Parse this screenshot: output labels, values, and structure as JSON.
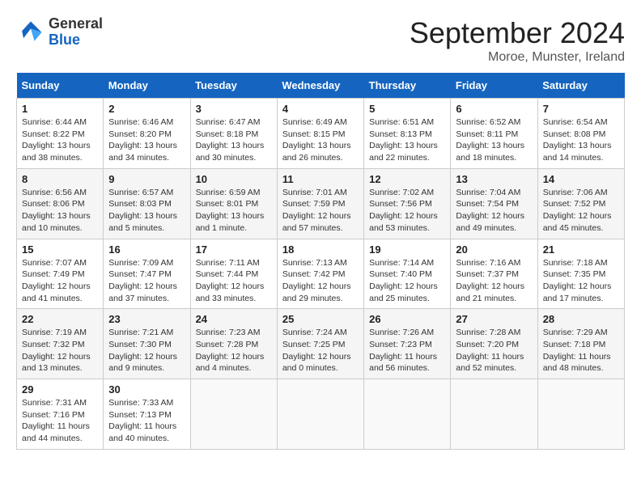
{
  "header": {
    "logo_line1": "General",
    "logo_line2": "Blue",
    "month": "September 2024",
    "location": "Moroe, Munster, Ireland"
  },
  "days_of_week": [
    "Sunday",
    "Monday",
    "Tuesday",
    "Wednesday",
    "Thursday",
    "Friday",
    "Saturday"
  ],
  "weeks": [
    [
      {
        "day": "1",
        "info": "Sunrise: 6:44 AM\nSunset: 8:22 PM\nDaylight: 13 hours\nand 38 minutes."
      },
      {
        "day": "2",
        "info": "Sunrise: 6:46 AM\nSunset: 8:20 PM\nDaylight: 13 hours\nand 34 minutes."
      },
      {
        "day": "3",
        "info": "Sunrise: 6:47 AM\nSunset: 8:18 PM\nDaylight: 13 hours\nand 30 minutes."
      },
      {
        "day": "4",
        "info": "Sunrise: 6:49 AM\nSunset: 8:15 PM\nDaylight: 13 hours\nand 26 minutes."
      },
      {
        "day": "5",
        "info": "Sunrise: 6:51 AM\nSunset: 8:13 PM\nDaylight: 13 hours\nand 22 minutes."
      },
      {
        "day": "6",
        "info": "Sunrise: 6:52 AM\nSunset: 8:11 PM\nDaylight: 13 hours\nand 18 minutes."
      },
      {
        "day": "7",
        "info": "Sunrise: 6:54 AM\nSunset: 8:08 PM\nDaylight: 13 hours\nand 14 minutes."
      }
    ],
    [
      {
        "day": "8",
        "info": "Sunrise: 6:56 AM\nSunset: 8:06 PM\nDaylight: 13 hours\nand 10 minutes."
      },
      {
        "day": "9",
        "info": "Sunrise: 6:57 AM\nSunset: 8:03 PM\nDaylight: 13 hours\nand 5 minutes."
      },
      {
        "day": "10",
        "info": "Sunrise: 6:59 AM\nSunset: 8:01 PM\nDaylight: 13 hours\nand 1 minute."
      },
      {
        "day": "11",
        "info": "Sunrise: 7:01 AM\nSunset: 7:59 PM\nDaylight: 12 hours\nand 57 minutes."
      },
      {
        "day": "12",
        "info": "Sunrise: 7:02 AM\nSunset: 7:56 PM\nDaylight: 12 hours\nand 53 minutes."
      },
      {
        "day": "13",
        "info": "Sunrise: 7:04 AM\nSunset: 7:54 PM\nDaylight: 12 hours\nand 49 minutes."
      },
      {
        "day": "14",
        "info": "Sunrise: 7:06 AM\nSunset: 7:52 PM\nDaylight: 12 hours\nand 45 minutes."
      }
    ],
    [
      {
        "day": "15",
        "info": "Sunrise: 7:07 AM\nSunset: 7:49 PM\nDaylight: 12 hours\nand 41 minutes."
      },
      {
        "day": "16",
        "info": "Sunrise: 7:09 AM\nSunset: 7:47 PM\nDaylight: 12 hours\nand 37 minutes."
      },
      {
        "day": "17",
        "info": "Sunrise: 7:11 AM\nSunset: 7:44 PM\nDaylight: 12 hours\nand 33 minutes."
      },
      {
        "day": "18",
        "info": "Sunrise: 7:13 AM\nSunset: 7:42 PM\nDaylight: 12 hours\nand 29 minutes."
      },
      {
        "day": "19",
        "info": "Sunrise: 7:14 AM\nSunset: 7:40 PM\nDaylight: 12 hours\nand 25 minutes."
      },
      {
        "day": "20",
        "info": "Sunrise: 7:16 AM\nSunset: 7:37 PM\nDaylight: 12 hours\nand 21 minutes."
      },
      {
        "day": "21",
        "info": "Sunrise: 7:18 AM\nSunset: 7:35 PM\nDaylight: 12 hours\nand 17 minutes."
      }
    ],
    [
      {
        "day": "22",
        "info": "Sunrise: 7:19 AM\nSunset: 7:32 PM\nDaylight: 12 hours\nand 13 minutes."
      },
      {
        "day": "23",
        "info": "Sunrise: 7:21 AM\nSunset: 7:30 PM\nDaylight: 12 hours\nand 9 minutes."
      },
      {
        "day": "24",
        "info": "Sunrise: 7:23 AM\nSunset: 7:28 PM\nDaylight: 12 hours\nand 4 minutes."
      },
      {
        "day": "25",
        "info": "Sunrise: 7:24 AM\nSunset: 7:25 PM\nDaylight: 12 hours\nand 0 minutes."
      },
      {
        "day": "26",
        "info": "Sunrise: 7:26 AM\nSunset: 7:23 PM\nDaylight: 11 hours\nand 56 minutes."
      },
      {
        "day": "27",
        "info": "Sunrise: 7:28 AM\nSunset: 7:20 PM\nDaylight: 11 hours\nand 52 minutes."
      },
      {
        "day": "28",
        "info": "Sunrise: 7:29 AM\nSunset: 7:18 PM\nDaylight: 11 hours\nand 48 minutes."
      }
    ],
    [
      {
        "day": "29",
        "info": "Sunrise: 7:31 AM\nSunset: 7:16 PM\nDaylight: 11 hours\nand 44 minutes."
      },
      {
        "day": "30",
        "info": "Sunrise: 7:33 AM\nSunset: 7:13 PM\nDaylight: 11 hours\nand 40 minutes."
      },
      null,
      null,
      null,
      null,
      null
    ]
  ]
}
